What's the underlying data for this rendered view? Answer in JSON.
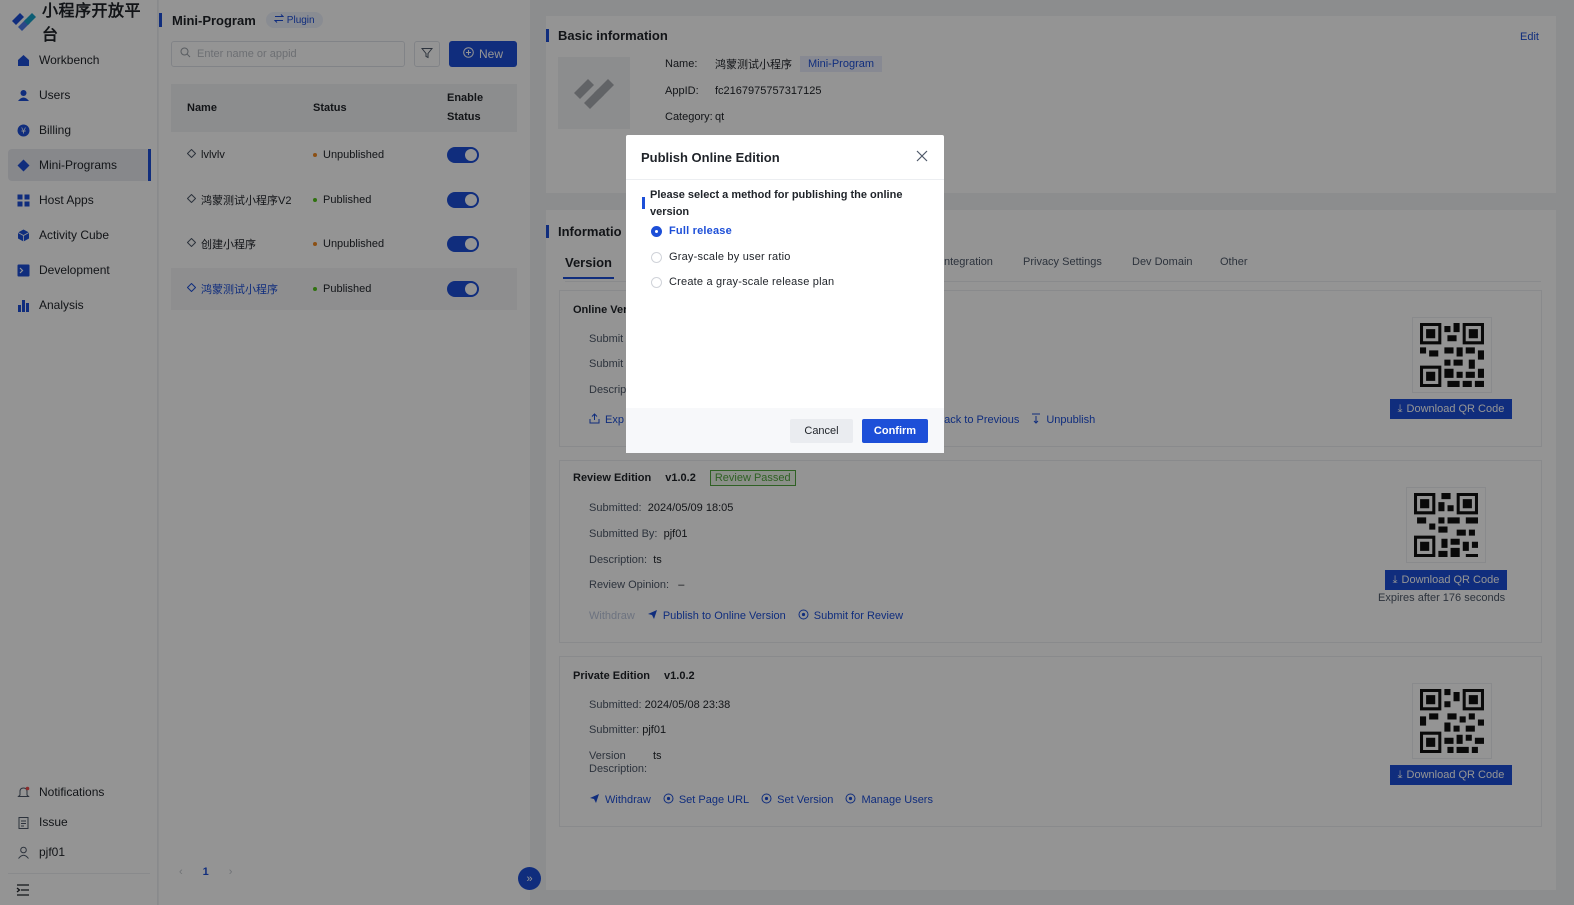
{
  "brand": {
    "name": "小程序开放平台"
  },
  "sidebar": {
    "items": [
      {
        "label": "Workbench",
        "icon": "home-icon",
        "active": false
      },
      {
        "label": "Users",
        "icon": "user-icon",
        "active": false
      },
      {
        "label": "Billing",
        "icon": "billing-icon",
        "active": false
      },
      {
        "label": "Mini-Programs",
        "icon": "diamond-icon",
        "active": true
      },
      {
        "label": "Host Apps",
        "icon": "grid-icon",
        "active": false
      },
      {
        "label": "Activity Cube",
        "icon": "cube-icon",
        "active": false
      },
      {
        "label": "Development",
        "icon": "terminal-icon",
        "active": false
      },
      {
        "label": "Analysis",
        "icon": "bar-chart-icon",
        "active": false
      }
    ],
    "bottom": [
      {
        "label": "Notifications",
        "icon": "bell-icon"
      },
      {
        "label": "Issue",
        "icon": "clipboard-icon"
      },
      {
        "label": "pjf01",
        "icon": "profile-icon"
      }
    ]
  },
  "list": {
    "title": "Mini-Program",
    "plugin_label": "Plugin",
    "search_placeholder": "Enter name or appid",
    "new_label": "New",
    "columns": {
      "name": "Name",
      "status": "Status",
      "enable": "Enable Status"
    },
    "rows": [
      {
        "name": "lvlvlv",
        "status": "Unpublished",
        "status_color": "#f08a24",
        "enabled": true,
        "selected": false
      },
      {
        "name": "鸿蒙测试小程序V2",
        "status": "Published",
        "status_color": "#52c41a",
        "enabled": true,
        "selected": false
      },
      {
        "name": "创建小程序",
        "status": "Unpublished",
        "status_color": "#f08a24",
        "enabled": true,
        "selected": false
      },
      {
        "name": "鸿蒙测试小程序",
        "status": "Published",
        "status_color": "#52c41a",
        "enabled": true,
        "selected": true
      }
    ],
    "page": "1"
  },
  "basic": {
    "title": "Basic information",
    "edit_label": "Edit",
    "name_key": "Name:",
    "name_value": "鸿蒙测试小程序",
    "type_tag": "Mini-Program",
    "appid_key": "AppID:",
    "appid_value": "fc2167975757317125",
    "category_key": "Category:",
    "category_value": "qt"
  },
  "info": {
    "title": "Informatio",
    "tabs": [
      "Version",
      "ntegration",
      "Privacy Settings",
      "Dev Domain",
      "Other"
    ],
    "online": {
      "title": "Online Ver",
      "submitted_key": "Submit",
      "submitted_by_key": "Submit",
      "description_key": "Descrip",
      "action_export": "Exp",
      "action_back": "back to Previous",
      "action_unpublish": "Unpublish",
      "download_label": "Download QR Code"
    },
    "review": {
      "title": "Review Edition",
      "version": "v1.0.2",
      "badge": "Review Passed",
      "submitted_key": "Submitted:",
      "submitted_value": "2024/05/09 18:05",
      "submitted_by_key": "Submitted By:",
      "submitted_by_value": "pjf01",
      "description_key": "Description:",
      "description_value": "ts",
      "opinion_key": "Review Opinion:",
      "opinion_value": "–",
      "action_withdraw": "Withdraw",
      "action_publish": "Publish to Online Version",
      "action_submit": "Submit for Review",
      "download_label": "Download QR Code",
      "expires": "Expires after 176 seconds"
    },
    "private": {
      "title": "Private Edition",
      "version": "v1.0.2",
      "submitted_key": "Submitted:",
      "submitted_value": "2024/05/08 23:38",
      "submitter_key": "Submitter:",
      "submitter_value": "pjf01",
      "description_key_1": "Version",
      "description_key_2": "Description:",
      "description_value": "ts",
      "action_withdraw": "Withdraw",
      "action_page_url": "Set Page URL",
      "action_set_version": "Set Version",
      "action_manage_users": "Manage Users",
      "download_label": "Download QR Code"
    }
  },
  "modal": {
    "title": "Publish Online Edition",
    "question": "Please select a method for publishing the online version",
    "options": [
      {
        "label": "Full release",
        "selected": true
      },
      {
        "label": "Gray-scale by user ratio",
        "selected": false
      },
      {
        "label": "Create a gray-scale release plan",
        "selected": false
      }
    ],
    "cancel_label": "Cancel",
    "confirm_label": "Confirm"
  },
  "colors": {
    "accent": "#1d4fd8",
    "published": "#52c41a",
    "unpublished": "#f08a24",
    "passed": "#52a63f"
  }
}
